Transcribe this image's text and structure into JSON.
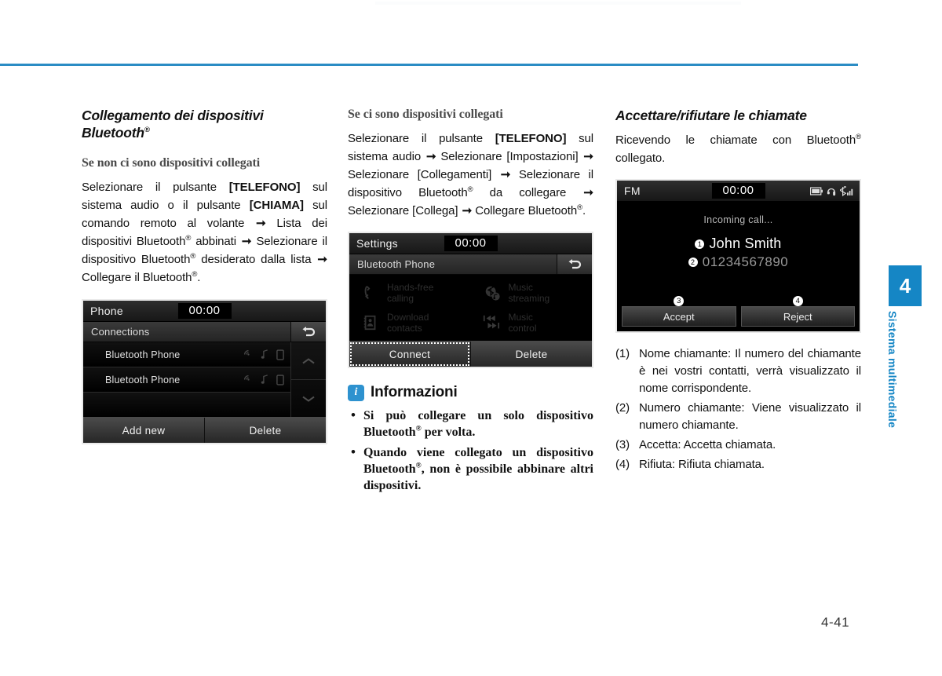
{
  "page": {
    "number": "4-41",
    "chapter_number": "4",
    "chapter_label": "Sistema multimediale",
    "accent_color": "#1586c5",
    "rule_color": "#2b8cc4"
  },
  "col1": {
    "section_title_line1": "Collegamento dei dispositivi",
    "section_title_line2": "Bluetooth",
    "section_title_reg": "®",
    "sub_title": "Se non ci sono dispositivi collegati",
    "body_html": "Selezionare il pulsante [TELEFONO] sul sistema audio o il pulsante [CHIAMA] sul comando remoto al volante ➟ Lista dei dispositivi Bluetooth® abbinati ➟ Selezionare il dispositivo Bluetooth® desiderato dalla lista ➟ Collegare il Bluetooth®.",
    "screen": {
      "source": "Phone",
      "clock": "00:00",
      "title": "Connections",
      "back_icon": "back-arrow-icon",
      "rows": [
        {
          "name": "Bluetooth Phone",
          "icons": [
            "bluetooth-audio-icon",
            "music-note-icon",
            "phone-device-icon"
          ]
        },
        {
          "name": "Bluetooth Phone",
          "icons": [
            "bluetooth-audio-icon",
            "music-note-icon",
            "phone-device-icon"
          ]
        },
        {
          "name": "",
          "icons": []
        }
      ],
      "scroll_up_icon": "chevron-up-icon",
      "scroll_down_icon": "chevron-down-icon",
      "buttons": [
        {
          "label": "Add new",
          "selected": false
        },
        {
          "label": "Delete",
          "selected": false
        }
      ]
    }
  },
  "col2": {
    "sub_title": "Se ci sono dispositivi collegati",
    "body_html": "Selezionare il pulsante [TELEFONO] sul sistema audio ➟ Selezionare [Impostazioni] ➟ Selezionare [Collegamenti] ➟ Selezionare il dispositivo Bluetooth® da collegare ➟ Selezionare [Collega] ➟ Collegare Bluetooth®.",
    "screen": {
      "source": "Settings",
      "clock": "00:00",
      "title": "Bluetooth Phone",
      "back_icon": "back-arrow-icon",
      "features": [
        {
          "label_line1": "Hands-free",
          "label_line2": "calling",
          "icon": "handset-icon"
        },
        {
          "label_line1": "Music",
          "label_line2": "streaming",
          "icon": "bluetooth-music-icon"
        },
        {
          "label_line1": "Download",
          "label_line2": "contacts",
          "icon": "contacts-download-icon"
        },
        {
          "label_line1": "Music",
          "label_line2": "control",
          "icon": "track-skip-icon"
        }
      ],
      "buttons": [
        {
          "label": "Connect",
          "selected": true
        },
        {
          "label": "Delete",
          "selected": false
        }
      ]
    },
    "info": {
      "icon": "info-icon",
      "title": "Informazioni",
      "items": [
        "Si può collegare un solo dispositivo Bluetooth® per volta.",
        "Quando viene collegato un dispositivo Bluetooth®, non è possibile abbinare altri dispositivi."
      ]
    }
  },
  "col3": {
    "section_title": "Accettare/rifiutare le chiamate",
    "body_html": "Ricevendo le chiamate con Bluetooth® collegato.",
    "screen": {
      "source": "FM",
      "clock": "00:00",
      "status_icons": [
        "battery-icon",
        "headset-icon",
        "bluetooth-signal-icon"
      ],
      "call_status": "Incoming call...",
      "caller_name": "John Smith",
      "caller_name_marker": "1",
      "caller_number": "01234567890",
      "caller_number_marker": "2",
      "accept_label": "Accept",
      "accept_marker": "3",
      "reject_label": "Reject",
      "reject_marker": "4"
    },
    "numbered_items": [
      {
        "idx": "(1)",
        "text": "Nome chiamante: Il numero del chiamante è nei vostri contatti, verrà visualizzato il nome corrispondente.",
        "short": false
      },
      {
        "idx": "(2)",
        "text": "Numero chiamante: Viene visualizzato il numero chiamante.",
        "short": false
      },
      {
        "idx": "(3)",
        "text": "Accetta: Accetta chiamata.",
        "short": true
      },
      {
        "idx": "(4)",
        "text": "Rifiuta: Rifiuta chiamata.",
        "short": true
      }
    ]
  }
}
